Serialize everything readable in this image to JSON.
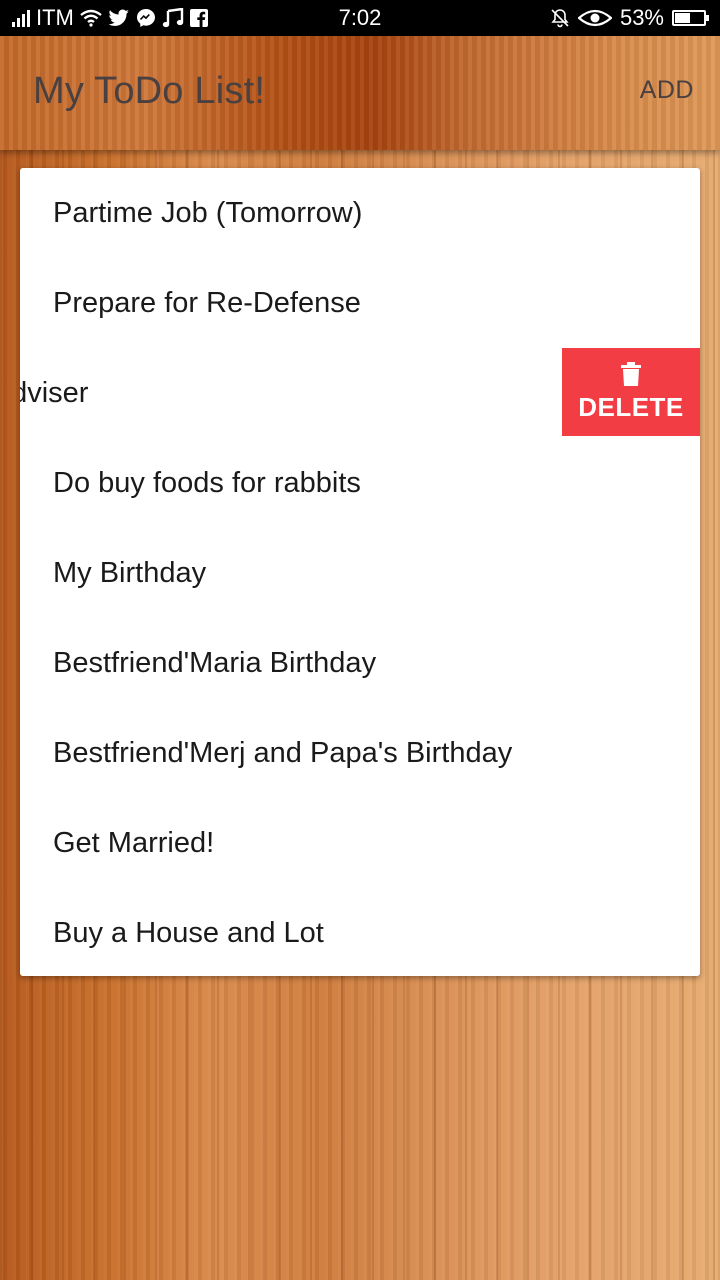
{
  "status_bar": {
    "carrier": "ITM",
    "time": "7:02",
    "battery_percent": "53%",
    "battery_level": 0.53
  },
  "app_bar": {
    "title": "My ToDo List!",
    "add_label": "ADD"
  },
  "todos": [
    {
      "label": "Partime Job (Tomorrow)"
    },
    {
      "label": "Prepare for Re-Defense"
    },
    {
      "label": "t to Adviser",
      "swiped": true
    },
    {
      "label": "Do buy foods for rabbits"
    },
    {
      "label": "My Birthday"
    },
    {
      "label": "Bestfriend'Maria Birthday"
    },
    {
      "label": "Bestfriend'Merj and Papa's Birthday"
    },
    {
      "label": "Get Married!"
    },
    {
      "label": "Buy a House and Lot"
    }
  ],
  "swipe_action": {
    "label": "DELETE",
    "icon": "trash-icon",
    "color": "#f23d45"
  }
}
